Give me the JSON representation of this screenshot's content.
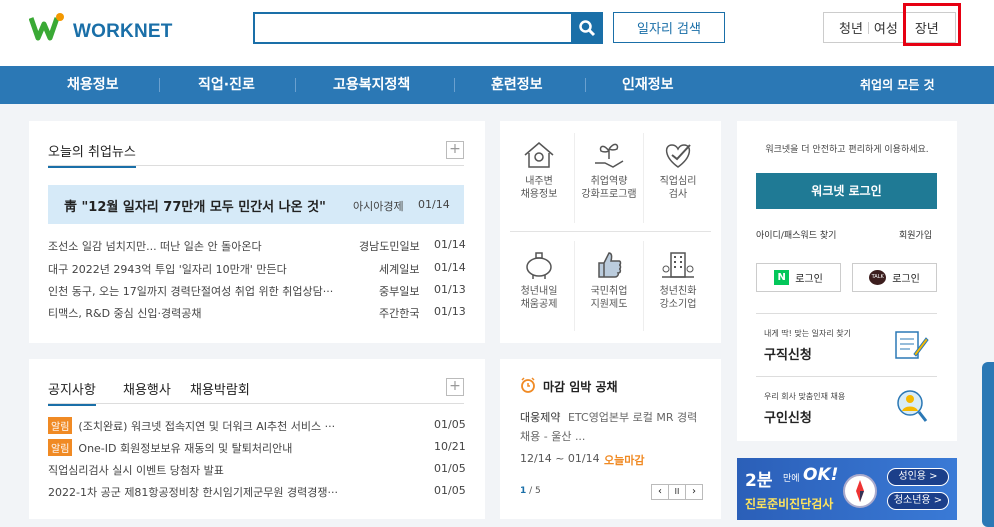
{
  "header": {
    "logo_text": "WORKNET",
    "search_placeholder": "",
    "job_search_label": "일자리 검색",
    "segments": [
      "청년",
      "여성",
      "장년"
    ]
  },
  "nav": {
    "items": [
      "채용정보",
      "직업·진로",
      "고용복지정책",
      "훈련정보",
      "인재정보"
    ],
    "all_label": "취업의 모든 것"
  },
  "news": {
    "title": "오늘의 취업뉴스",
    "headline": {
      "text": "靑 \"12월 일자리 77만개 모두 민간서 나온 것\"",
      "source": "아시아경제",
      "date": "01/14"
    },
    "items": [
      {
        "text": "조선소 일감 넘치지만... 떠난 일손 안 돌아온다",
        "source": "경남도민일보",
        "date": "01/14"
      },
      {
        "text": "대구 2022년 2943억 투입 '일자리 10만개' 만든다",
        "source": "세계일보",
        "date": "01/14"
      },
      {
        "text": "인천 동구, 오는 17일까지 경력단절여성 취업 위한 취업상담···",
        "source": "중부일보",
        "date": "01/13"
      },
      {
        "text": "티맥스, R&D 중심 신입·경력공채",
        "source": "주간한국",
        "date": "01/13"
      }
    ]
  },
  "quick": {
    "items": [
      {
        "label": "내주변\n채용정보",
        "icon": "house-map-icon"
      },
      {
        "label": "취업역량\n강화프로그램",
        "icon": "sprout-hand-icon"
      },
      {
        "label": "직업심리\n검사",
        "icon": "heart-check-icon"
      },
      {
        "label": "청년내일\n채움공제",
        "icon": "piggy-bank-icon"
      },
      {
        "label": "국민취업\n지원제도",
        "icon": "thumbs-up-icon"
      },
      {
        "label": "청년친화\n강소기업",
        "icon": "building-icon"
      }
    ]
  },
  "login": {
    "notice": "워크넷을 더 안전하고 편리하게 이용하세요.",
    "button": "워크넷 로그인",
    "find_link": "아이디/패스워드 찾기",
    "join_link": "회원가입",
    "naver_label": "로그인",
    "kakao_label": "로그인",
    "naver_badge": "N",
    "kakao_badge": "TALK"
  },
  "job_request": {
    "sub": "내게 딱! 맞는 일자리 찾기",
    "title": "구직신청"
  },
  "talent_request": {
    "sub": "우리 회사 맞춤인재 채용",
    "title": "구인신청"
  },
  "notice": {
    "tabs": [
      "공지사항",
      "채용행사",
      "채용박람회"
    ],
    "items": [
      {
        "tag": "알림",
        "text": "(조치완료) 워크넷 접속지연 및 더워크 AI추천 서비스 ···",
        "date": "01/05"
      },
      {
        "tag": "알림",
        "text": "One-ID 회원정보보유 재동의 및 탈퇴처리안내",
        "date": "10/21"
      },
      {
        "tag": "",
        "text": "직업심리검사 실시 이벤트 당첨자 발표",
        "date": "01/05"
      },
      {
        "tag": "",
        "text": "2022-1차 공군 제81항공정비창 한시임기제군무원 경력경쟁···",
        "date": "01/05"
      }
    ]
  },
  "deadline": {
    "title": "마감 임박 공채",
    "company": "대웅제약",
    "desc": "ETC영업본부 로컬 MR 경력",
    "desc2": "채용 - 울산 ...",
    "period": "12/14 ~ 01/14",
    "status": "오늘마감",
    "page_current": "1",
    "page_total": "/ 5"
  },
  "banner": {
    "big": "2분",
    "small": "만에",
    "ok": "OK!",
    "sub": "진로준비진단검사",
    "btn1": "성인용 >",
    "btn2": "청소년용 >"
  },
  "colors": {
    "brand": "#1a6fa8",
    "nav": "#2b78b5",
    "login_btn": "#1f7a95",
    "orange": "#f08a24"
  }
}
